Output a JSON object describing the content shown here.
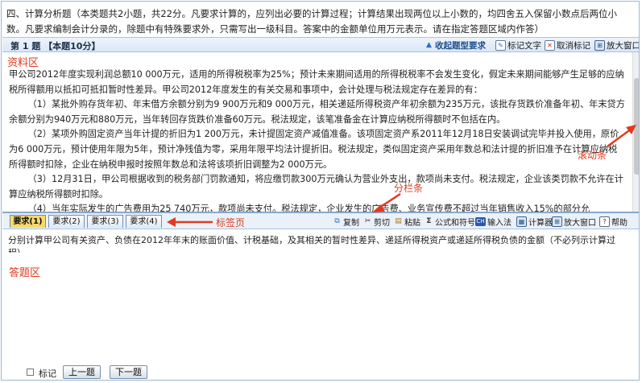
{
  "instructions": "四、计算分析题（本类题共2小题，共22分。凡要求计算的，应列出必要的计算过程；计算结果出现两位以上小数的，均四舍五入保留小数点后两位小数。凡要求编制会计分录的，除题中有特殊要求外，只需写出一级科目。答案中的金额单位用万元表示。请在指定答题区域内作答）",
  "question_bar": {
    "title": "第 1 题 【本题10分】",
    "tools": [
      {
        "label": "收起题型要求",
        "icon": "collapse-icon"
      },
      {
        "label": "标记文字",
        "icon": "highlight-text-icon"
      },
      {
        "label": "取消标记",
        "icon": "clear-mark-icon"
      },
      {
        "label": "放大窗口",
        "icon": "enlarge-window-icon"
      }
    ]
  },
  "material": {
    "label": "资料区",
    "paragraphs": [
      "甲公司2012年度实现利润总额10 000万元，适用的所得税税率为25%；预计未来期间适用的所得税税率不会发生变化，假定未来期间能够产生足够的应纳税所得额用以抵扣可抵扣暂时性差异。甲公司2012年度发生的有关交易和事项中，会计处理与税法规定存在差异的有：",
      "（1）某批外购存货年初、年末借方余额分别为9 900万元和9 000万元，相关递延所得税资产年初余额为235万元，该批存货跌价准备年初、年末贷方余额分别为940万元和880万元，当年转回存货跌价准备60万元。税法规定，该笔准备金在计算应纳税所得额时不包括在内。",
      "（2）某项外购固定资产当年计提的折旧为1 200万元，未计提固定资产减值准备。该项固定资产系2011年12月18日安装调试完毕并投入使用，原价为6 000万元，预计使用年限为5年，预计净残值为零，采用年限平均法计提折旧。税法规定，类似固定资产采用年数总和法计提的折旧准予在计算应纳税所得额时扣除，企业在纳税申报时按照年数总和法将该项折旧调整为2 000万元。",
      "（3）12月31日，甲公司根据收到的税务部门罚款通知，将应缴罚款300万元确认为营业外支出，款项尚未支付。税法规定，企业该类罚款不允许在计算应纳税所得额时扣除。",
      "（4）当年实际发生的广告费用为25 740万元，款项尚未支付。税法规定，企业发生的广告费、业务宣传费不超过当年销售收入15%的部分允"
    ]
  },
  "tabs": [
    "要求(1)",
    "要求(2)",
    "要求(3)",
    "要求(4)"
  ],
  "toolbar": {
    "copy": "复制",
    "cut": "剪切",
    "paste": "粘贴",
    "formula": "公式和符号",
    "input_method": "输入法",
    "calculator": "计算器",
    "enlarge": "放大窗口",
    "help": "帮助"
  },
  "requirement": "分别计算甲公司有关资产、负债在2012年年末的账面价值、计税基础，及其相关的暂时性差异、递延所得税资产或递延所得税负债的金额（不必列示计算过程）。",
  "answer_label": "答题区",
  "footer": {
    "mark": "标记",
    "prev": "上一题",
    "next": "下一题"
  },
  "annotations": {
    "scrollbar": "滚动条",
    "splitter": "分栏条",
    "tabs": "标签页"
  }
}
